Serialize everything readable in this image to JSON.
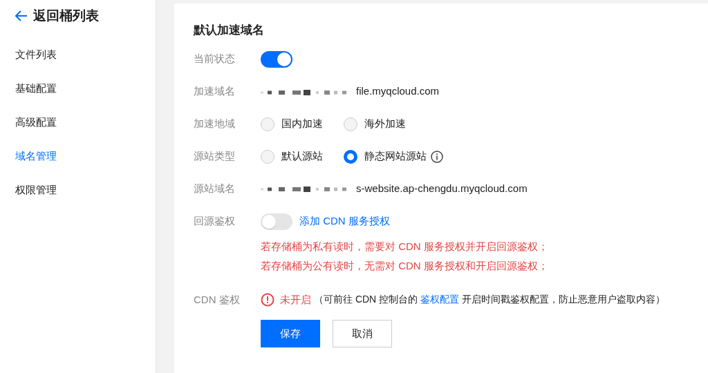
{
  "back": {
    "label": "返回桶列表"
  },
  "sidebar": {
    "items": [
      {
        "label": "文件列表",
        "selected": false
      },
      {
        "label": "基础配置",
        "selected": false
      },
      {
        "label": "高级配置",
        "selected": false
      },
      {
        "label": "域名管理",
        "selected": true
      },
      {
        "label": "权限管理",
        "selected": false
      }
    ]
  },
  "card": {
    "title": "默认加速域名",
    "rows": [
      {
        "kind": "toggle",
        "label": "当前状态",
        "on": true
      },
      {
        "kind": "text",
        "label": "加速域名",
        "redacted": true,
        "value": "file.myqcloud.com"
      },
      {
        "kind": "radio",
        "label": "加速地域",
        "options": [
          {
            "label": "国内加速",
            "selected": false
          },
          {
            "label": "海外加速",
            "selected": false
          }
        ]
      },
      {
        "kind": "radio",
        "label": "源站类型",
        "info": true,
        "options": [
          {
            "label": "默认源站",
            "selected": false
          },
          {
            "label": "静态网站源站",
            "selected": true
          }
        ]
      },
      {
        "kind": "text",
        "label": "源站域名",
        "redacted": true,
        "value": "s-website.ap-chengdu.myqcloud.com"
      },
      {
        "kind": "toggle",
        "label": "回源鉴权",
        "on": false,
        "link": "添加 CDN 服务授权"
      }
    ],
    "notes": [
      "若存储桶为私有读时，需要对 CDN 服务授权并开启回源鉴权；",
      "若存储桶为公有读时，无需对 CDN 服务授权和开启回源鉴权；"
    ],
    "cdn_auth": {
      "label": "CDN 鉴权",
      "status": "未开启",
      "hint_before": "（可前往 CDN 控制台的",
      "hint_link": "鉴权配置",
      "hint_after": "开启时间戳鉴权配置，防止恶意用户盗取内容）"
    },
    "buttons": [
      {
        "label": "保存",
        "kind": "primary"
      },
      {
        "label": "取消",
        "kind": "secondary"
      }
    ]
  }
}
